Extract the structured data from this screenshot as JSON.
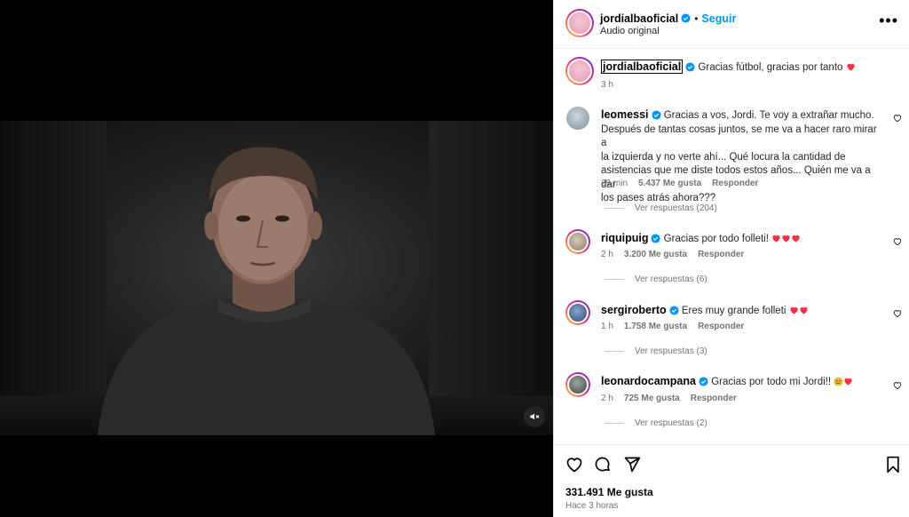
{
  "post": {
    "author": "jordialbaoficial",
    "follow_label": "Seguir",
    "audio": "Audio original",
    "caption_user": "jordialbaoficial",
    "caption_text": "Gracias fútbol, gracias por tanto",
    "caption_time": "3 h",
    "likes": "331.491 Me gusta",
    "time_ago": "Hace 3 horas"
  },
  "comments": [
    {
      "user": "leomessi",
      "lines": [
        "Gracias a vos, Jordi. Te voy a extrañar mucho.",
        "Después de tantas cosas juntos, se me va a hacer raro mirar a",
        "la izquierda y no verte ahí... Qué locura la cantidad de",
        "asistencias que me diste todos estos años... Quién me va a dar",
        "los pases atrás ahora???"
      ],
      "time": "29 min",
      "likes": "5.437 Me gusta",
      "reply_label": "Responder",
      "view_replies": "Ver respuestas (204)"
    },
    {
      "user": "riquipuig",
      "text": "Gracias por todo folleti!",
      "time": "2 h",
      "likes": "3.200 Me gusta",
      "reply_label": "Responder",
      "view_replies": "Ver respuestas (6)"
    },
    {
      "user": "sergiroberto",
      "text": "Eres muy grande folleti",
      "time": "1 h",
      "likes": "1.758 Me gusta",
      "reply_label": "Responder",
      "view_replies": "Ver respuestas (3)"
    },
    {
      "user": "leonardocampana",
      "text": "Gracias por todo mi Jordi!!",
      "time": "2 h",
      "likes": "725 Me gusta",
      "reply_label": "Responder",
      "view_replies": "Ver respuestas (2)"
    }
  ],
  "colors": {
    "accent": "#0095f6",
    "heart": "#ff3040",
    "muted": "#737373"
  },
  "icons": [
    "more-icon",
    "verified-icon",
    "heart-icon",
    "comment-icon",
    "share-icon",
    "bookmark-icon",
    "mute-icon"
  ]
}
